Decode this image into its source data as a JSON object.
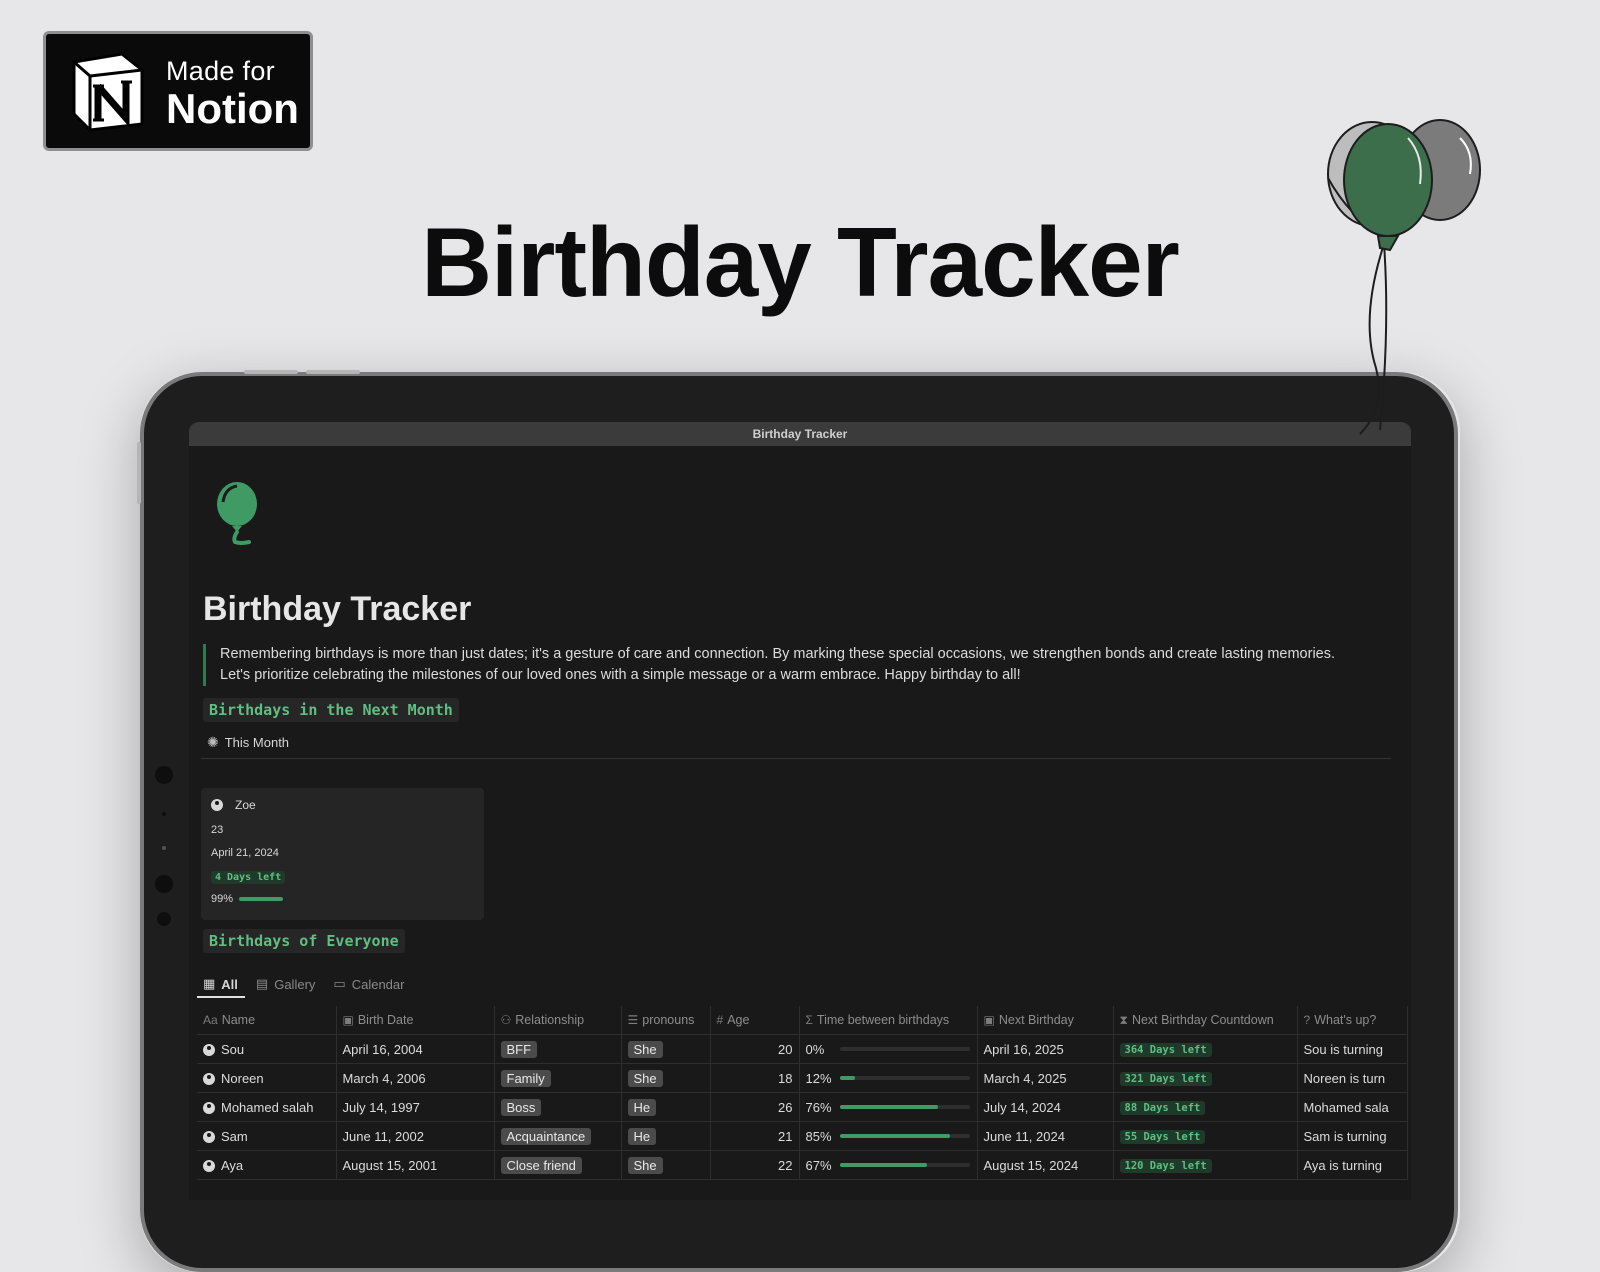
{
  "badge": {
    "line1": "Made for",
    "line2": "Notion"
  },
  "hero": {
    "title": "Birthday Tracker"
  },
  "window": {
    "title": "Birthday Tracker"
  },
  "page": {
    "title": "Birthday Tracker",
    "quote_line1": "Remembering birthdays is more than just dates; it's a gesture of care and connection. By marking these special occasions, we strengthen bonds and create lasting memories.",
    "quote_line2": "Let's prioritize celebrating the milestones of our loved ones with a simple message or a warm embrace. Happy birthday to all!"
  },
  "next_month": {
    "heading": "Birthdays in the Next Month",
    "view_label": "This Month",
    "card": {
      "name": "Zoe",
      "age": "23",
      "date": "April 21, 2024",
      "countdown": "4 Days left",
      "progress_label": "99%",
      "progress": 0.99
    }
  },
  "everyone": {
    "heading": "Birthdays of Everyone",
    "tabs": [
      {
        "label": "All",
        "icon": "table-icon"
      },
      {
        "label": "Gallery",
        "icon": "gallery-icon"
      },
      {
        "label": "Calendar",
        "icon": "calendar-icon"
      }
    ],
    "columns": [
      {
        "icon": "Aa",
        "label": "Name"
      },
      {
        "icon": "▣",
        "label": "Birth Date"
      },
      {
        "icon": "⚇",
        "label": "Relationship"
      },
      {
        "icon": "☰",
        "label": "pronouns"
      },
      {
        "icon": "#",
        "label": "Age"
      },
      {
        "icon": "Σ",
        "label": "Time between birthdays"
      },
      {
        "icon": "▣",
        "label": "Next Birthday"
      },
      {
        "icon": "⧗",
        "label": "Next Birthday Countdown"
      },
      {
        "icon": "?",
        "label": "What's up?"
      }
    ],
    "rows": [
      {
        "name": "Sou",
        "birth": "April 16, 2004",
        "rel": "BFF",
        "pron": "She",
        "age": "20",
        "pct": "0%",
        "frac": 0.0,
        "next": "April 16, 2025",
        "cd": "364 Days left",
        "whats": "Sou  is turning"
      },
      {
        "name": "Noreen",
        "birth": "March 4, 2006",
        "rel": "Family",
        "pron": "She",
        "age": "18",
        "pct": "12%",
        "frac": 0.12,
        "next": "March 4, 2025",
        "cd": "321 Days left",
        "whats": "Noreen is turn"
      },
      {
        "name": "Mohamed salah",
        "birth": "July 14, 1997",
        "rel": "Boss",
        "pron": "He",
        "age": "26",
        "pct": "76%",
        "frac": 0.76,
        "next": "July 14, 2024",
        "cd": "88 Days left",
        "whats": "Mohamed sala"
      },
      {
        "name": "Sam",
        "birth": "June 11, 2002",
        "rel": "Acquaintance",
        "pron": "He",
        "age": "21",
        "pct": "85%",
        "frac": 0.85,
        "next": "June 11, 2024",
        "cd": "55 Days left",
        "whats": "Sam is turning"
      },
      {
        "name": "Aya",
        "birth": "August 15, 2001",
        "rel": "Close friend",
        "pron": "She",
        "age": "22",
        "pct": "67%",
        "frac": 0.67,
        "next": "August 15, 2024",
        "cd": "120 Days left",
        "whats": "Aya is turning"
      }
    ]
  },
  "colors": {
    "accent": "#3f9a63",
    "code_text": "#5fbf82",
    "balloon_green": "#3c6e4c",
    "balloon_gray": "#7b7b7b"
  }
}
